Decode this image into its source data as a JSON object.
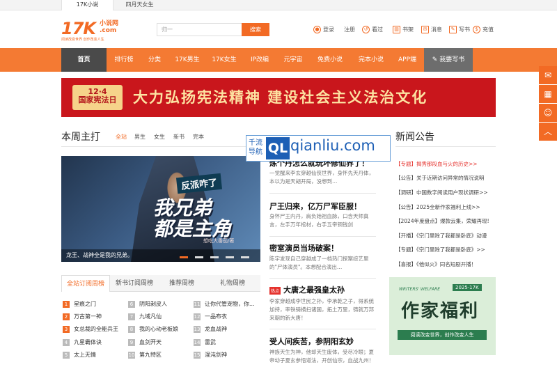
{
  "top_tabs": [
    "17K小说",
    "四月天女生"
  ],
  "logo": {
    "main": "17K",
    "side": "小说网\n.com",
    "slogan": "阅读改变世界  创作改变人生"
  },
  "search": {
    "placeholder": "归一",
    "button": "搜索"
  },
  "user_actions": [
    {
      "label": "登录",
      "icon": "user-icon"
    },
    {
      "label": "注册",
      "icon": "none"
    },
    {
      "label": "看过",
      "icon": "history-icon"
    },
    {
      "label": "书架",
      "icon": "bookshelf-icon"
    },
    {
      "label": "消息",
      "icon": "message-icon"
    },
    {
      "label": "写书",
      "icon": "write-icon"
    },
    {
      "label": "充值",
      "icon": "coin-icon"
    }
  ],
  "nav": [
    "首页",
    "排行榜",
    "分类",
    "17K男生",
    "17K女生",
    "IP改编",
    "元宇宙",
    "免费小说",
    "完本小说",
    "APP端",
    "我要写书"
  ],
  "banner": {
    "badge_date": "12·4",
    "badge_title": "国家宪法日",
    "slogan": "大力弘扬宪法精神 建设社会主义法治文化"
  },
  "weekly": {
    "title": "本周主打",
    "tabs": [
      "全站",
      "男生",
      "女生",
      "新书",
      "完本"
    ],
    "hero": {
      "tag": "反派咋了",
      "title": "我兄弟\n都是主角",
      "author": "想吃大番茄/著",
      "caption": "龙王、战神全是我的兄弟。"
    }
  },
  "books": [
    {
      "title": "炼个丹怎么就玩坏修仙界了！",
      "desc": "一觉醒来李玄穿越仙侠世界，身怀先天丹体，本以为是天胡开局，没想到…"
    },
    {
      "title": "尸王归来，亿万尸军臣服！",
      "desc": "身怀尸王内丹，肩负始祖血脉，口含天师真言，左手万年棺材，右手五帝铜钱剑"
    },
    {
      "title": "密室演员当场破案！",
      "desc": "陈宇发现自己穿越成了一档热门探案综艺里的\"尸体演员\"。本想配合演出…"
    },
    {
      "title": "大唐之最强皇太孙",
      "hot": "热点",
      "desc": "李家穿越成李世民之孙，李承乾之子，得系统加持，率铁骑横扫诸国，拓土万里，铸就万邦来朝的新大唐！"
    },
    {
      "title": "受人间疾苦，参阴阳玄妙",
      "desc": "神族天生为神，他却天生废体，受尽冷眼；夏帝幼子夏玄参悟道法，开创仙宗，血战九州！"
    }
  ],
  "news": {
    "title": "新闻公告",
    "items": [
      {
        "tag": "【专题】",
        "text": "揭秀那段血与火的历史>>",
        "red": true
      },
      {
        "tag": "【公告】",
        "text": "关于近期访问异常的情况说明"
      },
      {
        "tag": "【调研】",
        "text": "中国数字阅读用户现状调研>>"
      },
      {
        "tag": "【公告】",
        "text": "2025全新作家福利上线>>"
      },
      {
        "tag": "【2024年度盘点】",
        "text": "爆款云集，荣耀再现!"
      },
      {
        "tag": "【开播】",
        "text": "《宗门里除了我都是卧底》动漫"
      },
      {
        "tag": "【专题】",
        "text": "《宗门里除了我都是卧底》>>"
      },
      {
        "tag": "【喜报】",
        "text": "《他似火》同名短剧开播！"
      }
    ]
  },
  "ad": {
    "top": "WRITERS' WELFARE",
    "badge": "2025·17K",
    "title": "作家福利",
    "sub": "阅读改变世界，创作改变人生"
  },
  "ranking": {
    "tabs": [
      "全站订阅周榜",
      "新书订阅周榜",
      "推荐周榜",
      "礼物周榜"
    ],
    "col1": [
      "星痕之门",
      "万古第一神",
      "女总裁的全能兵王",
      "九星霸体诀",
      "太上无情"
    ],
    "col2": [
      "阴阳剥皮人",
      "九域凡仙",
      "我的心动老板娘",
      "血剑开天",
      "第九特区"
    ],
    "col3": [
      "让你代管宠物，你...",
      "一品布衣",
      "龙血战神",
      "雷武",
      "混沌剑神"
    ]
  },
  "watermark": {
    "cn": "千流导航",
    "ql": "QL",
    "url": "qianliu.com"
  },
  "side_icons": [
    "wechat-icon",
    "qrcode-icon",
    "service-icon",
    "back-to-top-icon"
  ],
  "colors": {
    "accent": "#f26a24",
    "nav": "#f47a33",
    "banner": "#c9161c"
  }
}
